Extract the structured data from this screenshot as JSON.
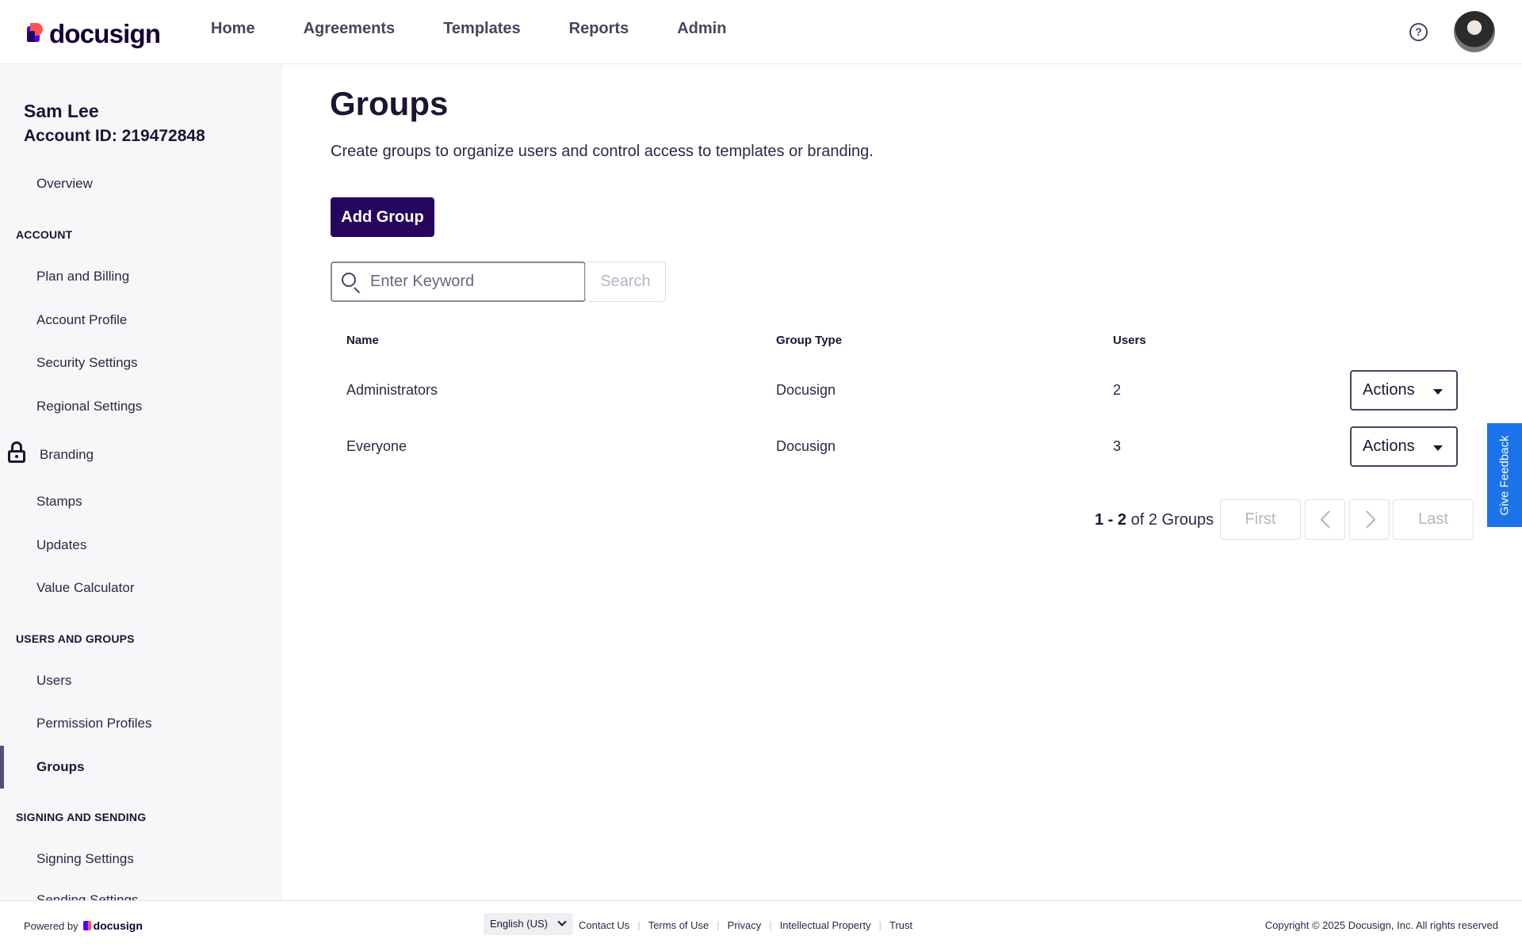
{
  "header": {
    "logo_text": "docusign",
    "nav": [
      "Home",
      "Agreements",
      "Templates",
      "Reports",
      "Admin"
    ],
    "help_glyph": "?"
  },
  "sidebar": {
    "user_name": "Sam Lee",
    "account_id": "Account ID: 219472848",
    "overview": "Overview",
    "sections": [
      {
        "heading": "ACCOUNT",
        "items": [
          "Plan and Billing",
          "Account Profile",
          "Security Settings",
          "Regional Settings",
          "Branding",
          "Stamps",
          "Updates",
          "Value Calculator"
        ]
      },
      {
        "heading": "USERS AND GROUPS",
        "items": [
          "Users",
          "Permission Profiles",
          "Groups"
        ]
      },
      {
        "heading": "SIGNING AND SENDING",
        "items": [
          "Signing Settings",
          "Sending Settings"
        ]
      }
    ],
    "active_item": "Groups"
  },
  "main": {
    "title": "Groups",
    "description": "Create groups to organize users and control access to templates or branding.",
    "add_button": "Add Group",
    "search": {
      "placeholder": "Enter Keyword",
      "value": "",
      "button": "Search"
    },
    "table": {
      "columns": [
        "Name",
        "Group Type",
        "Users"
      ],
      "rows": [
        {
          "name": "Administrators",
          "type": "Docusign",
          "users": "2",
          "action": "Actions"
        },
        {
          "name": "Everyone",
          "type": "Docusign",
          "users": "3",
          "action": "Actions"
        }
      ]
    },
    "pagination": {
      "range": "1 - 2",
      "of_text": "of 2 Groups",
      "first": "First",
      "last": "Last"
    }
  },
  "feedback_tab": "Give Feedback",
  "footer": {
    "powered_by": "Powered by",
    "logo_text": "docusign",
    "language": "English (US)",
    "links": [
      "Contact Us",
      "Terms of Use",
      "Privacy",
      "Intellectual Property",
      "Trust"
    ],
    "copyright": "Copyright © 2025 Docusign, Inc. All rights reserved"
  },
  "colors": {
    "brand_dark": "#26065d",
    "brand_purple": "#4c00ff",
    "brand_coral": "#ff5252",
    "feedback_blue": "#1a73e8"
  }
}
